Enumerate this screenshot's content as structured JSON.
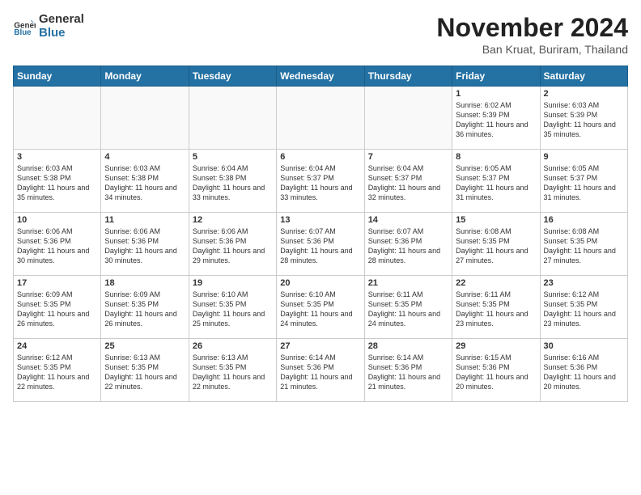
{
  "header": {
    "logo_general": "General",
    "logo_blue": "Blue",
    "month_title": "November 2024",
    "location": "Ban Kruat, Buriram, Thailand"
  },
  "weekdays": [
    "Sunday",
    "Monday",
    "Tuesday",
    "Wednesday",
    "Thursday",
    "Friday",
    "Saturday"
  ],
  "weeks": [
    [
      {
        "day": "",
        "info": ""
      },
      {
        "day": "",
        "info": ""
      },
      {
        "day": "",
        "info": ""
      },
      {
        "day": "",
        "info": ""
      },
      {
        "day": "",
        "info": ""
      },
      {
        "day": "1",
        "info": "Sunrise: 6:02 AM\nSunset: 5:39 PM\nDaylight: 11 hours and 36 minutes."
      },
      {
        "day": "2",
        "info": "Sunrise: 6:03 AM\nSunset: 5:39 PM\nDaylight: 11 hours and 35 minutes."
      }
    ],
    [
      {
        "day": "3",
        "info": "Sunrise: 6:03 AM\nSunset: 5:38 PM\nDaylight: 11 hours and 35 minutes."
      },
      {
        "day": "4",
        "info": "Sunrise: 6:03 AM\nSunset: 5:38 PM\nDaylight: 11 hours and 34 minutes."
      },
      {
        "day": "5",
        "info": "Sunrise: 6:04 AM\nSunset: 5:38 PM\nDaylight: 11 hours and 33 minutes."
      },
      {
        "day": "6",
        "info": "Sunrise: 6:04 AM\nSunset: 5:37 PM\nDaylight: 11 hours and 33 minutes."
      },
      {
        "day": "7",
        "info": "Sunrise: 6:04 AM\nSunset: 5:37 PM\nDaylight: 11 hours and 32 minutes."
      },
      {
        "day": "8",
        "info": "Sunrise: 6:05 AM\nSunset: 5:37 PM\nDaylight: 11 hours and 31 minutes."
      },
      {
        "day": "9",
        "info": "Sunrise: 6:05 AM\nSunset: 5:37 PM\nDaylight: 11 hours and 31 minutes."
      }
    ],
    [
      {
        "day": "10",
        "info": "Sunrise: 6:06 AM\nSunset: 5:36 PM\nDaylight: 11 hours and 30 minutes."
      },
      {
        "day": "11",
        "info": "Sunrise: 6:06 AM\nSunset: 5:36 PM\nDaylight: 11 hours and 30 minutes."
      },
      {
        "day": "12",
        "info": "Sunrise: 6:06 AM\nSunset: 5:36 PM\nDaylight: 11 hours and 29 minutes."
      },
      {
        "day": "13",
        "info": "Sunrise: 6:07 AM\nSunset: 5:36 PM\nDaylight: 11 hours and 28 minutes."
      },
      {
        "day": "14",
        "info": "Sunrise: 6:07 AM\nSunset: 5:36 PM\nDaylight: 11 hours and 28 minutes."
      },
      {
        "day": "15",
        "info": "Sunrise: 6:08 AM\nSunset: 5:35 PM\nDaylight: 11 hours and 27 minutes."
      },
      {
        "day": "16",
        "info": "Sunrise: 6:08 AM\nSunset: 5:35 PM\nDaylight: 11 hours and 27 minutes."
      }
    ],
    [
      {
        "day": "17",
        "info": "Sunrise: 6:09 AM\nSunset: 5:35 PM\nDaylight: 11 hours and 26 minutes."
      },
      {
        "day": "18",
        "info": "Sunrise: 6:09 AM\nSunset: 5:35 PM\nDaylight: 11 hours and 26 minutes."
      },
      {
        "day": "19",
        "info": "Sunrise: 6:10 AM\nSunset: 5:35 PM\nDaylight: 11 hours and 25 minutes."
      },
      {
        "day": "20",
        "info": "Sunrise: 6:10 AM\nSunset: 5:35 PM\nDaylight: 11 hours and 24 minutes."
      },
      {
        "day": "21",
        "info": "Sunrise: 6:11 AM\nSunset: 5:35 PM\nDaylight: 11 hours and 24 minutes."
      },
      {
        "day": "22",
        "info": "Sunrise: 6:11 AM\nSunset: 5:35 PM\nDaylight: 11 hours and 23 minutes."
      },
      {
        "day": "23",
        "info": "Sunrise: 6:12 AM\nSunset: 5:35 PM\nDaylight: 11 hours and 23 minutes."
      }
    ],
    [
      {
        "day": "24",
        "info": "Sunrise: 6:12 AM\nSunset: 5:35 PM\nDaylight: 11 hours and 22 minutes."
      },
      {
        "day": "25",
        "info": "Sunrise: 6:13 AM\nSunset: 5:35 PM\nDaylight: 11 hours and 22 minutes."
      },
      {
        "day": "26",
        "info": "Sunrise: 6:13 AM\nSunset: 5:35 PM\nDaylight: 11 hours and 22 minutes."
      },
      {
        "day": "27",
        "info": "Sunrise: 6:14 AM\nSunset: 5:36 PM\nDaylight: 11 hours and 21 minutes."
      },
      {
        "day": "28",
        "info": "Sunrise: 6:14 AM\nSunset: 5:36 PM\nDaylight: 11 hours and 21 minutes."
      },
      {
        "day": "29",
        "info": "Sunrise: 6:15 AM\nSunset: 5:36 PM\nDaylight: 11 hours and 20 minutes."
      },
      {
        "day": "30",
        "info": "Sunrise: 6:16 AM\nSunset: 5:36 PM\nDaylight: 11 hours and 20 minutes."
      }
    ]
  ]
}
